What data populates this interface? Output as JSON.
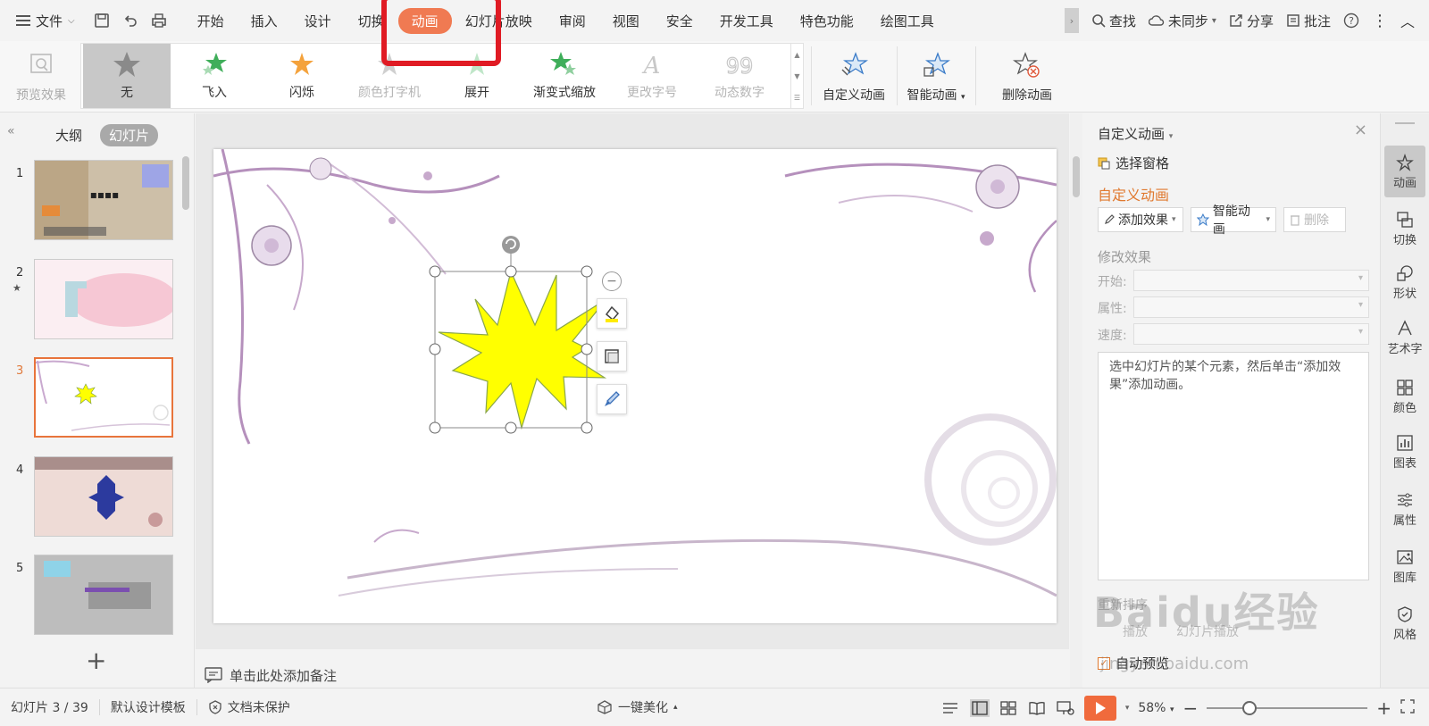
{
  "menubar": {
    "file_label": "文件",
    "tabs": [
      "开始",
      "插入",
      "设计",
      "切换",
      "动画",
      "幻灯片放映",
      "审阅",
      "视图",
      "安全",
      "开发工具",
      "特色功能",
      "绘图工具"
    ],
    "active_tab": "动画",
    "search_label": "查找",
    "sync_label": "未同步",
    "share_label": "分享",
    "comment_label": "批注"
  },
  "ribbon": {
    "preview_label": "预览效果",
    "gallery": [
      {
        "label": "无",
        "icon": "star-gray-icon"
      },
      {
        "label": "飞入",
        "icon": "star-green-fly-icon"
      },
      {
        "label": "闪烁",
        "icon": "star-orange-icon"
      },
      {
        "label": "颜色打字机",
        "icon": "star-typewriter-icon"
      },
      {
        "label": "展开",
        "icon": "star-expand-icon"
      },
      {
        "label": "渐变式缩放",
        "icon": "star-zoom-icon"
      },
      {
        "label": "更改字号",
        "icon": "font-size-icon"
      },
      {
        "label": "动态数字",
        "icon": "dynamic-number-icon"
      }
    ],
    "custom_anim_label": "自定义动画",
    "smart_anim_label": "智能动画",
    "delete_anim_label": "删除动画"
  },
  "left_panel": {
    "tab_outline": "大纲",
    "tab_slides": "幻灯片",
    "slides": [
      {
        "num": "1",
        "star": ""
      },
      {
        "num": "2",
        "star": "★"
      },
      {
        "num": "3",
        "star": ""
      },
      {
        "num": "4",
        "star": ""
      },
      {
        "num": "5",
        "star": ""
      }
    ],
    "active_slide": "3"
  },
  "notes_placeholder": "单击此处添加备注",
  "taskpane": {
    "title": "自定义动画",
    "select_pane_label": "选择窗格",
    "section_title": "自定义动画",
    "add_effect_label": "添加效果",
    "smart_anim_label": "智能动画",
    "delete_label": "删除",
    "modify_label": "修改效果",
    "start_label": "开始:",
    "property_label": "属性:",
    "speed_label": "速度:",
    "hint_text": "选中幻灯片的某个元素，然后单击“添加效果”添加动画。",
    "reorder_label": "重新排序",
    "play_label": "播放",
    "slideshow_label": "幻灯片播放",
    "auto_preview_label": "自动预览"
  },
  "rightbar": {
    "items": [
      "动画",
      "切换",
      "形状",
      "艺术字",
      "颜色",
      "图表",
      "属性",
      "图库",
      "风格"
    ]
  },
  "statusbar": {
    "slide_counter": "幻灯片 3 / 39",
    "template_label": "默认设计模板",
    "protect_label": "文档未保护",
    "beautify_label": "一键美化",
    "zoom_label": "58%"
  },
  "watermark": {
    "main": "Baidu经验",
    "sub": "jingyan.baidu.com"
  },
  "colors": {
    "accent": "#f07a52",
    "highlight": "#e01b24",
    "star_fill": "#ffff00"
  }
}
